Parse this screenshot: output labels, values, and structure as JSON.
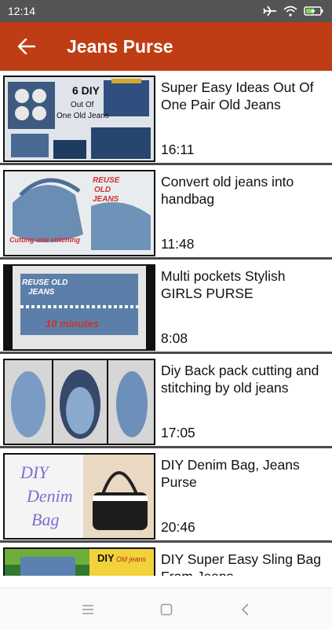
{
  "status": {
    "time": "12:14"
  },
  "app_bar": {
    "title": "Jeans Purse"
  },
  "videos": [
    {
      "title": "Super Easy Ideas Out Of One Pair Old Jeans",
      "duration": "16:11",
      "thumb_text": [
        "6 DIY",
        "Out Of",
        "One Old Jeans"
      ]
    },
    {
      "title": "Convert old jeans into handbag",
      "duration": "11:48",
      "thumb_text": [
        "REUSE",
        "OLD",
        "JEANS",
        "Cutting and stitching"
      ]
    },
    {
      "title": "Multi pockets Stylish GIRLS PURSE",
      "duration": "8:08",
      "thumb_text": [
        "REUSE OLD",
        "JEANS",
        "10 minutes"
      ]
    },
    {
      "title": "Diy Back pack cutting and stitching by old jeans",
      "duration": "17:05",
      "thumb_text": []
    },
    {
      "title": "DIY Denim Bag, Jeans Purse",
      "duration": "20:46",
      "thumb_text": [
        "DIY",
        "Denim",
        "Bag"
      ]
    },
    {
      "title": "DIY Super Easy Sling Bag From Jeans",
      "duration": "",
      "thumb_text": [
        "DIY",
        "Old jeans"
      ]
    }
  ]
}
